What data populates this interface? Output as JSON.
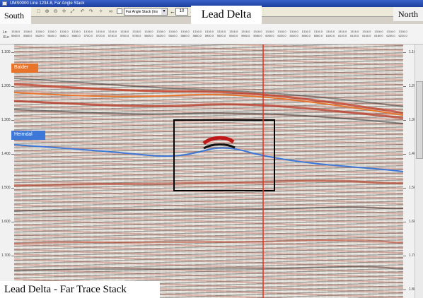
{
  "window": {
    "title": "UMS0000 Line 1234.8, Far Angle Stack"
  },
  "toolbar": {
    "select_value": "Far Angle Stack (Ins",
    "nav_prev": "←",
    "nav_next": "→",
    "step_value": "10"
  },
  "labels": {
    "south": "South",
    "north": "North",
    "title": "Lead Delta",
    "caption": "Lead Delta - Far Trace Stack"
  },
  "header": {
    "row_keys": [
      "Ln",
      "XLn"
    ],
    "inline": "1316.0",
    "crosslines": [
      "5560.0",
      "5580.0",
      "5620.0",
      "5640.0",
      "5660.0",
      "5680.0",
      "5700.0",
      "5720.0",
      "5740.0",
      "5760.0",
      "5780.0",
      "5800.0",
      "5820.0",
      "5840.0",
      "5860.0",
      "5880.0",
      "5900.0",
      "5920.0",
      "5940.0",
      "5960.0",
      "5980.0",
      "6000.0",
      "6020.0",
      "6040.0",
      "6060.0",
      "6080.0",
      "6100.0",
      "6120.0",
      "6140.0",
      "6160.0",
      "6180.0",
      "6200.0",
      "6220.0"
    ]
  },
  "time_axis": {
    "left_ticks": [
      "1.100",
      "1.200",
      "1.300",
      "1.400",
      "1.500",
      "1.600",
      "1.700",
      "1.800"
    ],
    "right_ticks": [
      "1.100",
      "1.200",
      "1.300",
      "1.400",
      "1.500",
      "1.600",
      "1.700",
      "1.800"
    ]
  },
  "horizons": [
    {
      "name": "Balder",
      "color": "#e8742b"
    },
    {
      "name": "Heimdal",
      "color": "#3d78d8"
    }
  ],
  "colors": {
    "highlight_box": "#000000",
    "vertical_marker": "#e03020"
  }
}
